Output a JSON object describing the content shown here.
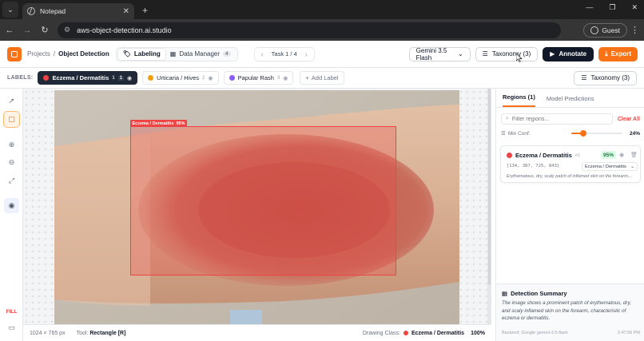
{
  "browser": {
    "tab_title": "Notepad",
    "url": "aws-object-detection.ai.studio",
    "profile_label": "Guest"
  },
  "header": {
    "breadcrumb_root": "Projects",
    "breadcrumb_current": "Object Detection",
    "mode_labeling": "Labeling",
    "mode_data_manager": "Data Manager",
    "data_manager_count": "4",
    "task_label": "Task 1 / 4",
    "model": "Gemini 3.5 Flash",
    "taxonomy_label": "Taxonomy (3)",
    "annotate_label": "Annotate",
    "export_label": "Export"
  },
  "labels_bar": {
    "title": "LABELS:",
    "labels": [
      {
        "name": "Eczema / Dermatitis",
        "count": "1",
        "key": "1",
        "color": "#ef4444"
      },
      {
        "name": "Urticaria / Hives",
        "count": "2",
        "color": "#f59e0b"
      },
      {
        "name": "Papular Rash",
        "count": "3",
        "color": "#8b5cf6"
      }
    ],
    "add_label": "Add Label",
    "taxonomy_label": "Taxonomy (3)"
  },
  "tools": {
    "fill_label": "FILL"
  },
  "canvas": {
    "box_label": "Eczema / Dermatitis",
    "box_score": "95%"
  },
  "status": {
    "dimensions": "1024 × 765 px",
    "tool_prefix": "Tool:",
    "tool_name": "Rectangle [R]",
    "drawing_class_prefix": "Drawing Class:",
    "drawing_class": "Eczema / Dermatitis",
    "zoom": "100%"
  },
  "panel": {
    "tab_regions": "Regions (1)",
    "tab_predictions": "Model Predictions",
    "filter_placeholder": "Filter regions...",
    "clear_all": "Clear All",
    "min_conf_label": "Min Conf:",
    "min_conf_value": "24%",
    "min_conf_fraction": 0.24,
    "region": {
      "name": "Eczema / Dermatitis",
      "key": "#1",
      "confidence": "95%",
      "coords": "[134, 387, 725, 843]",
      "class_select": "Eczema / Dermatitis",
      "description": "Erythematous, dry, scaly patch of inflamed skin on the forearm..."
    },
    "summary": {
      "title": "Detection Summary",
      "body": "The image shows a prominent patch of erythematous, dry, and scaly inflamed skin on the forearm, characteristic of eczema or dermatitis.",
      "backend": "Backend: Google gemini-3.5-flash",
      "timestamp": "2:47:56 PM"
    }
  },
  "colors": {
    "accent": "#f97316",
    "eczema": "#ef4444",
    "urticaria": "#f59e0b",
    "papular": "#8b5cf6",
    "confidence_badge": "#15803d"
  }
}
